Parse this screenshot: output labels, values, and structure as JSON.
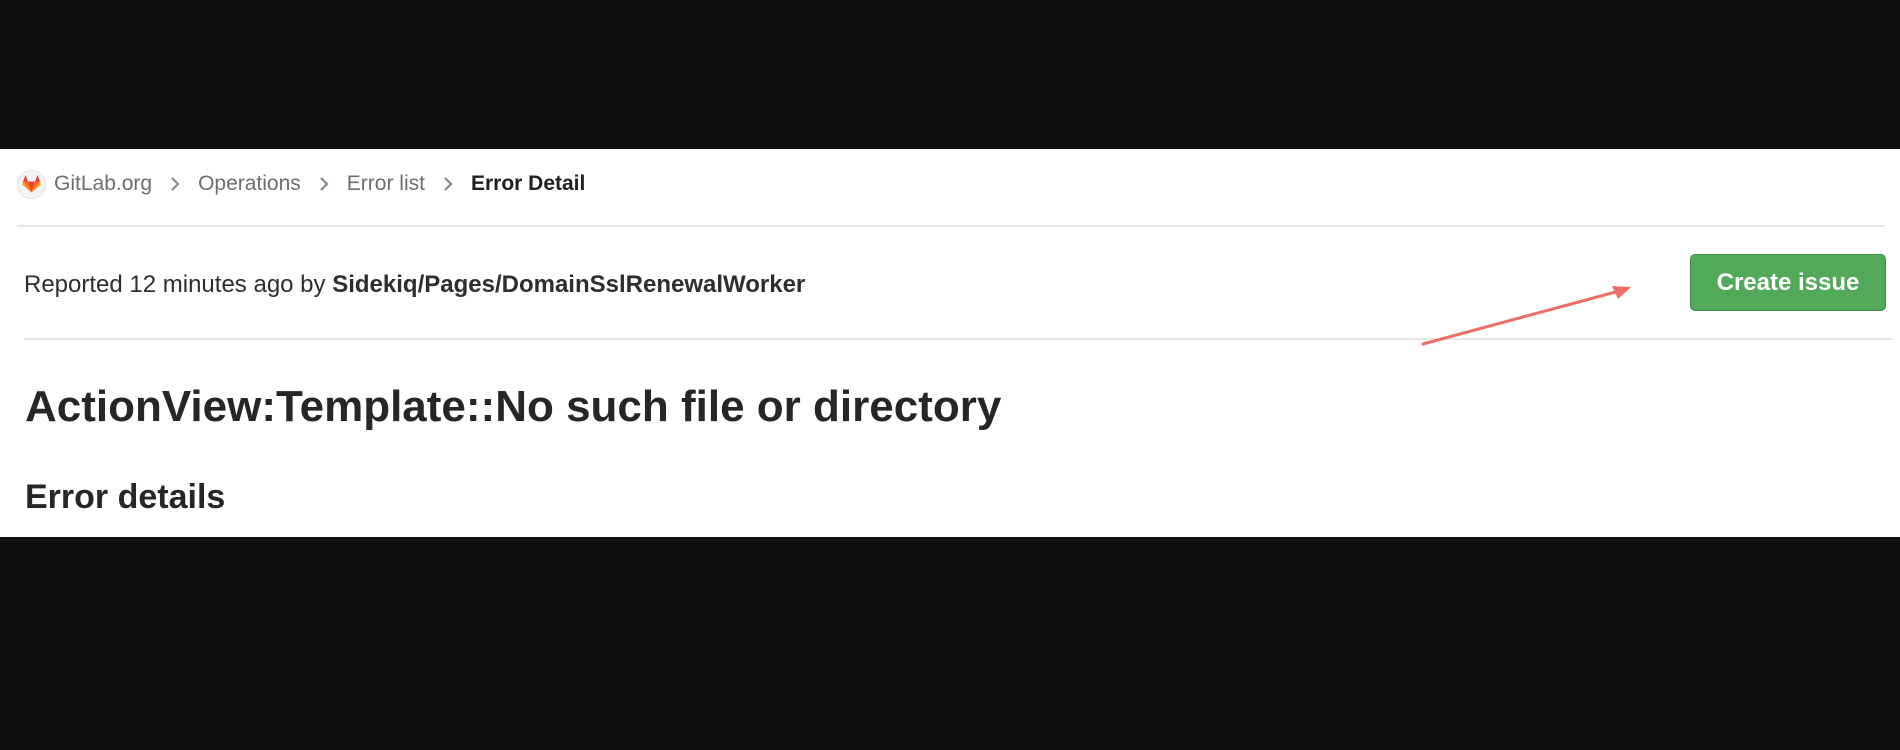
{
  "breadcrumb": {
    "items": [
      {
        "label": "GitLab.org"
      },
      {
        "label": "Operations"
      },
      {
        "label": "Error list"
      },
      {
        "label": "Error Detail"
      }
    ]
  },
  "header": {
    "reported_prefix": "Reported 12 minutes ago by",
    "reported_by": "Sidekiq/Pages/DomainSslRenewalWorker",
    "create_issue_label": "Create issue"
  },
  "main": {
    "error_title": "ActionView:Template::No such file or directory",
    "section_heading": "Error details"
  },
  "colors": {
    "primary_button": "#52a95a",
    "annotation_arrow": "#ea6f67",
    "logo": "#e2432a"
  },
  "icons": {
    "logo": "gitlab-tanuki-icon",
    "separator": "chevron-right-icon"
  }
}
